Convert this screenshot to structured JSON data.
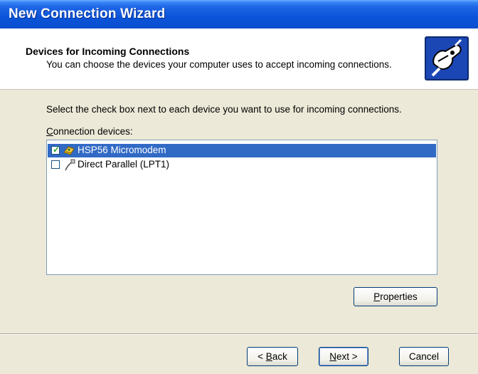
{
  "window": {
    "title": "New Connection Wizard"
  },
  "header": {
    "title": "Devices for Incoming Connections",
    "subtitle": "You can choose the devices your computer uses to accept incoming connections."
  },
  "main": {
    "instruction": "Select the check box next to each device you want to use for incoming connections.",
    "list_label_mnemonic": "C",
    "list_label_rest": "onnection devices:",
    "devices": [
      {
        "label": "HSP56 Micromodem",
        "checked": true,
        "selected": true,
        "icon": "modem-icon"
      },
      {
        "label": "Direct Parallel (LPT1)",
        "checked": false,
        "selected": false,
        "icon": "parallel-cable-icon"
      }
    ],
    "properties_mnemonic": "P",
    "properties_rest": "roperties"
  },
  "footer": {
    "back_lead": "< ",
    "back_mnemonic": "B",
    "back_rest": "ack",
    "next_mnemonic": "N",
    "next_rest": "ext >",
    "cancel_label": "Cancel"
  },
  "colors": {
    "titlebar": "#0a53d8",
    "selection": "#316ac5",
    "dialog_bg": "#ece9d8"
  }
}
